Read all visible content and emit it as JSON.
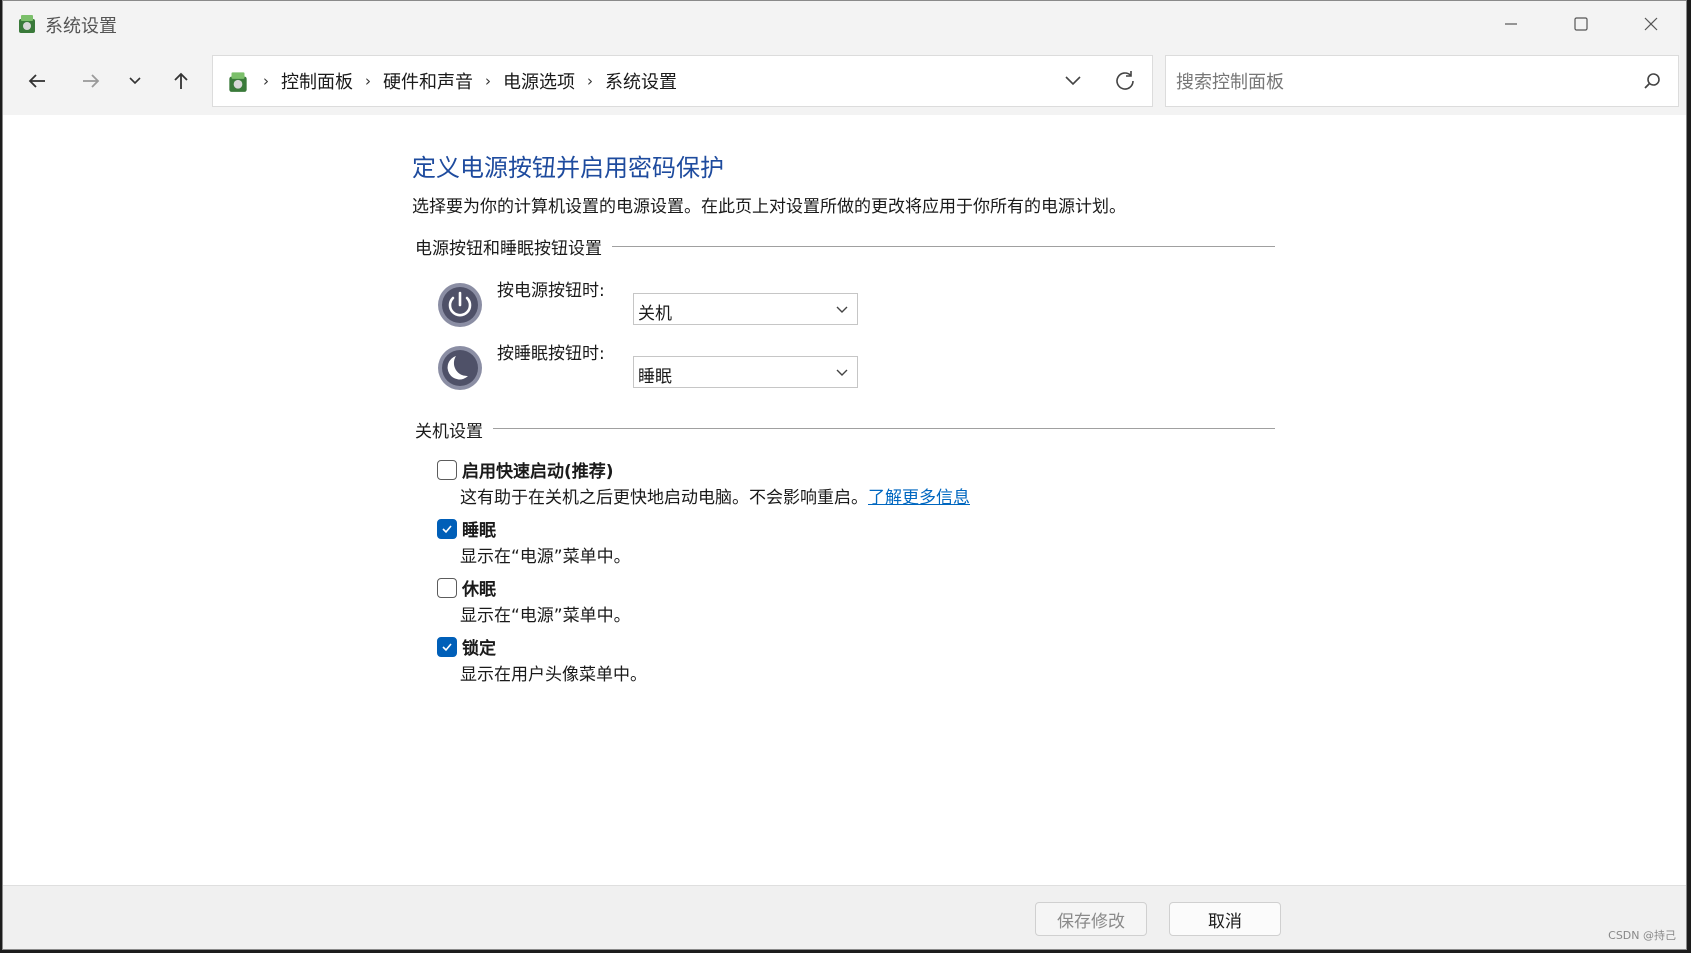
{
  "window": {
    "title": "系统设置",
    "app_icon": "power-options-icon"
  },
  "nav": {
    "back_icon": "arrow-left-icon",
    "forward_icon": "arrow-right-icon",
    "recent_icon": "chevron-down-icon",
    "up_icon": "arrow-up-icon"
  },
  "address": {
    "crumbs": [
      "控制面板",
      "硬件和声音",
      "电源选项",
      "系统设置"
    ]
  },
  "search": {
    "placeholder": "搜索控制面板"
  },
  "page": {
    "title": "定义电源按钮并启用密码保护",
    "description": "选择要为你的计算机设置的电源设置。在此页上对设置所做的更改将应用于你所有的电源计划。"
  },
  "buttons_group": {
    "header": "电源按钮和睡眠按钮设置",
    "power_label": "按电源按钮时:",
    "power_value": "关机",
    "sleep_label": "按睡眠按钮时:",
    "sleep_value": "睡眠"
  },
  "shutdown_group": {
    "header": "关机设置",
    "options": [
      {
        "label": "启用快速启动(推荐)",
        "desc": "这有助于在关机之后更快地启动电脑。不会影响重启。",
        "link": "了解更多信息",
        "checked": false
      },
      {
        "label": "睡眠",
        "desc": "显示在“电源”菜单中。",
        "checked": true
      },
      {
        "label": "休眠",
        "desc": "显示在“电源”菜单中。",
        "checked": false
      },
      {
        "label": "锁定",
        "desc": "显示在用户头像菜单中。",
        "checked": true
      }
    ]
  },
  "footer": {
    "save_label": "保存修改",
    "cancel_label": "取消",
    "watermark": "CSDN @持己"
  },
  "colors": {
    "accent": "#005fb8",
    "title_blue": "#1e4b9e",
    "link": "#0067c0"
  }
}
